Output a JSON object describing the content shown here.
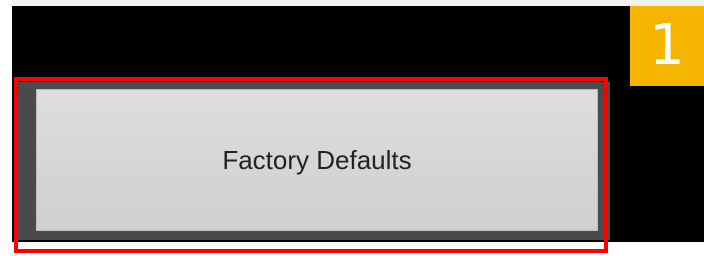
{
  "step_badge": {
    "number": "1",
    "color": "#f5b400"
  },
  "button": {
    "label": "Factory Defaults"
  },
  "highlight": {
    "color": "#ff0000"
  }
}
